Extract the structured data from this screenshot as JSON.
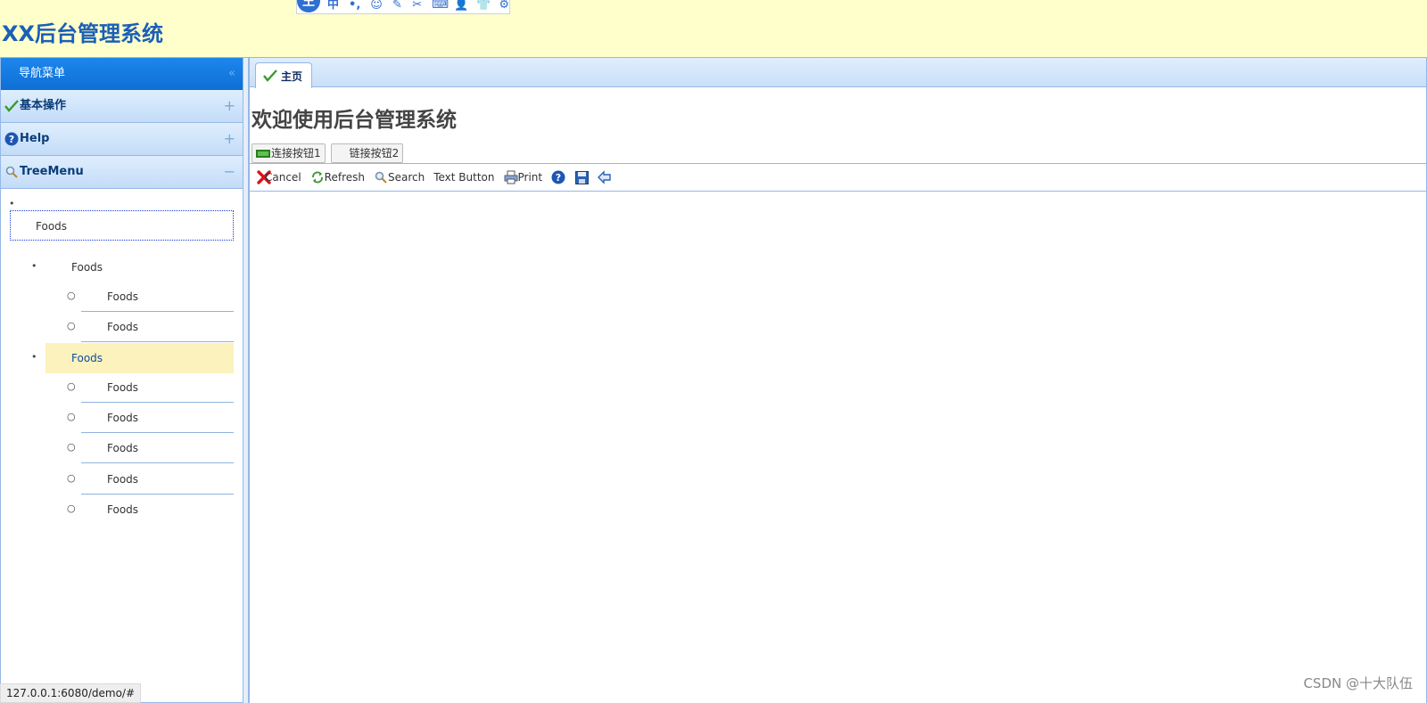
{
  "header": {
    "title": "XX后台管理系统",
    "ime_toolbar": {
      "logo": "王",
      "buttons": [
        "中",
        "•,",
        "☺",
        "✎",
        "✂",
        "⌨",
        "👤",
        "👕",
        "⚙"
      ]
    }
  },
  "sidebar": {
    "title": "导航菜单",
    "collapse_icon": "«",
    "panels": [
      {
        "title": "基本操作",
        "icon": "check-icon",
        "tool": "+"
      },
      {
        "title": "Help",
        "icon": "help-icon",
        "tool": "+"
      },
      {
        "title": "TreeMenu",
        "icon": "search-icon",
        "tool": "−"
      }
    ],
    "tree": {
      "root": "Foods",
      "groups": [
        {
          "label": "Foods",
          "selected": false,
          "children": [
            "Foods",
            "Foods"
          ]
        },
        {
          "label": "Foods",
          "selected": true,
          "children": [
            "Foods",
            "Foods",
            "Foods",
            "Foods",
            "Foods"
          ]
        }
      ]
    }
  },
  "status_url": "127.0.0.1:6080/demo/#",
  "main": {
    "tab_label": "主页",
    "heading": "欢迎使用后台管理系统",
    "link_buttons": [
      "连接按钮1",
      "链接按钮2"
    ],
    "toolbar": {
      "cancel": "Cancel",
      "refresh": "Refresh",
      "search": "Search",
      "text_button": "Text Button",
      "print": "Print"
    }
  },
  "watermark": "CSDN @十大队伍",
  "colors": {
    "header_bg": "#ffffcc",
    "title_blue": "#1b5fb6",
    "border_blue": "#95b8e7",
    "selected_bg": "#fbf2bd"
  }
}
